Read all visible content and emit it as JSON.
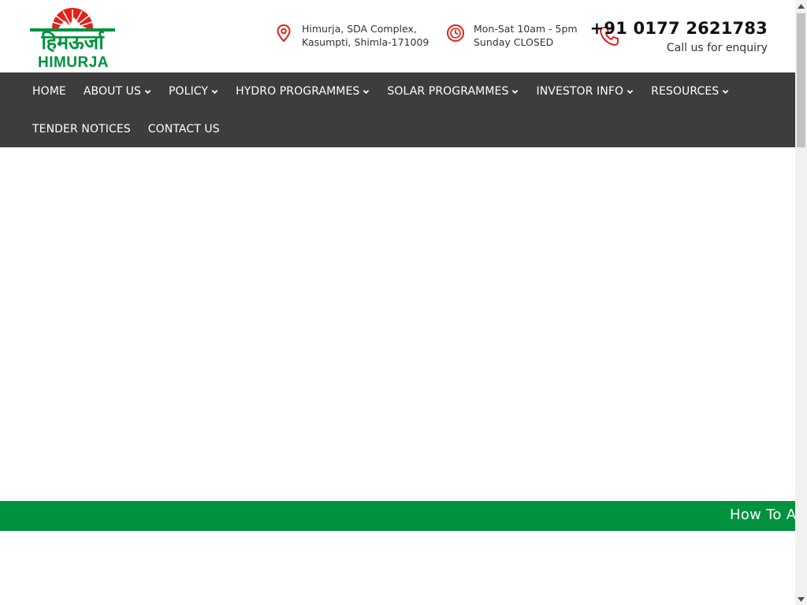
{
  "brand": {
    "logo_hindi": "हिमऊर्जा",
    "logo_english": "HIMURJA",
    "colors": {
      "green": "#00923f",
      "red": "#e0221b",
      "nav_bg": "#3d3d3d"
    }
  },
  "header": {
    "address": {
      "icon": "location-pin-icon",
      "line1": "Himurja, SDA Complex,",
      "line2": "Kasumpti, Shimla-171009"
    },
    "hours": {
      "icon": "clock-icon",
      "line1": "Mon-Sat 10am - 5pm",
      "line2": "Sunday CLOSED"
    },
    "contact": {
      "icon": "phone-icon",
      "phone": "+91 0177 2621783",
      "caption": "Call us for enquiry"
    }
  },
  "nav": {
    "row1": [
      {
        "label": "HOME",
        "dropdown": false
      },
      {
        "label": "ABOUT US",
        "dropdown": true
      },
      {
        "label": "POLICY",
        "dropdown": true
      },
      {
        "label": "HYDRO PROGRAMMES",
        "dropdown": true
      },
      {
        "label": "SOLAR PROGRAMMES",
        "dropdown": true
      },
      {
        "label": "INVESTOR INFO",
        "dropdown": true
      },
      {
        "label": "RESOURCES",
        "dropdown": true
      }
    ],
    "row2": [
      {
        "label": "TENDER NOTICES",
        "dropdown": false
      },
      {
        "label": "CONTACT US",
        "dropdown": false
      }
    ]
  },
  "ticker": {
    "text": "How To A"
  }
}
